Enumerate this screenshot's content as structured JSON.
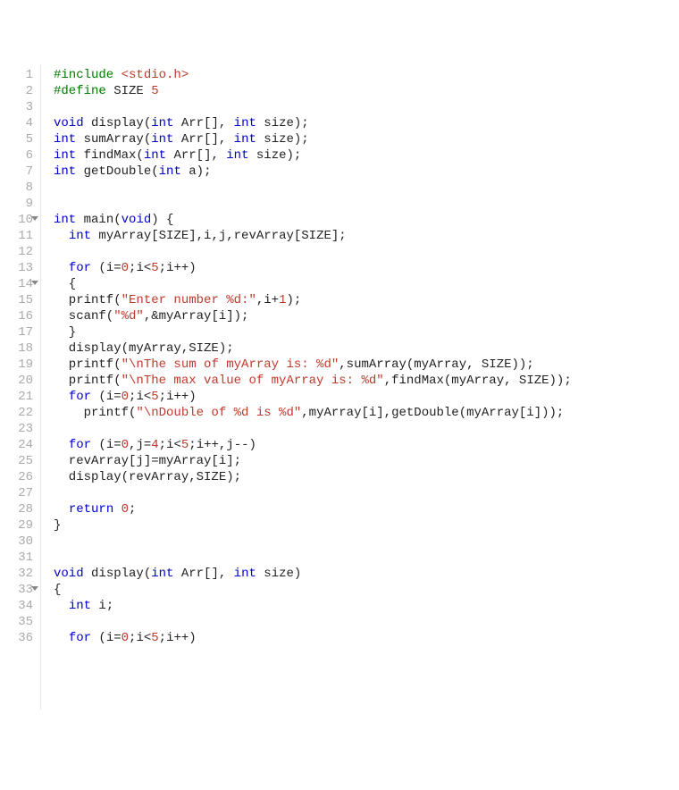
{
  "lines": [
    {
      "n": "1",
      "fold": false,
      "tokens": [
        [
          "pp",
          "#include "
        ],
        [
          "hdr",
          "<stdio.h>"
        ]
      ]
    },
    {
      "n": "2",
      "fold": false,
      "tokens": [
        [
          "pp",
          "#define "
        ],
        [
          "id",
          "SIZE "
        ],
        [
          "num",
          "5"
        ]
      ]
    },
    {
      "n": "3",
      "fold": false,
      "tokens": []
    },
    {
      "n": "4",
      "fold": false,
      "tokens": [
        [
          "kw",
          "void"
        ],
        [
          "id",
          " display("
        ],
        [
          "kw",
          "int"
        ],
        [
          "id",
          " Arr[], "
        ],
        [
          "kw",
          "int"
        ],
        [
          "id",
          " size);"
        ]
      ]
    },
    {
      "n": "5",
      "fold": false,
      "tokens": [
        [
          "kw",
          "int"
        ],
        [
          "id",
          " sumArray("
        ],
        [
          "kw",
          "int"
        ],
        [
          "id",
          " Arr[], "
        ],
        [
          "kw",
          "int"
        ],
        [
          "id",
          " size);"
        ]
      ]
    },
    {
      "n": "6",
      "fold": false,
      "tokens": [
        [
          "kw",
          "int"
        ],
        [
          "id",
          " findMax("
        ],
        [
          "kw",
          "int"
        ],
        [
          "id",
          " Arr[], "
        ],
        [
          "kw",
          "int"
        ],
        [
          "id",
          " size);"
        ]
      ]
    },
    {
      "n": "7",
      "fold": false,
      "tokens": [
        [
          "kw",
          "int"
        ],
        [
          "id",
          " getDouble("
        ],
        [
          "kw",
          "int"
        ],
        [
          "id",
          " a);"
        ]
      ]
    },
    {
      "n": "8",
      "fold": false,
      "tokens": []
    },
    {
      "n": "9",
      "fold": false,
      "tokens": []
    },
    {
      "n": "10",
      "fold": true,
      "tokens": [
        [
          "kw",
          "int"
        ],
        [
          "id",
          " main("
        ],
        [
          "kw",
          "void"
        ],
        [
          "id",
          ") {"
        ]
      ]
    },
    {
      "n": "11",
      "fold": false,
      "tokens": [
        [
          "id",
          "  "
        ],
        [
          "kw",
          "int"
        ],
        [
          "id",
          " myArray[SIZE],i,j,revArray[SIZE];"
        ]
      ]
    },
    {
      "n": "12",
      "fold": false,
      "tokens": [
        [
          "id",
          "  "
        ]
      ]
    },
    {
      "n": "13",
      "fold": false,
      "tokens": [
        [
          "id",
          "  "
        ],
        [
          "kw",
          "for"
        ],
        [
          "id",
          " (i="
        ],
        [
          "num",
          "0"
        ],
        [
          "id",
          ";i<"
        ],
        [
          "num",
          "5"
        ],
        [
          "id",
          ";i++)"
        ]
      ]
    },
    {
      "n": "14",
      "fold": true,
      "tokens": [
        [
          "id",
          "  {"
        ]
      ]
    },
    {
      "n": "15",
      "fold": false,
      "tokens": [
        [
          "id",
          "  printf("
        ],
        [
          "str",
          "\"Enter number %d:\""
        ],
        [
          "id",
          ",i+"
        ],
        [
          "num",
          "1"
        ],
        [
          "id",
          ");"
        ]
      ]
    },
    {
      "n": "16",
      "fold": false,
      "tokens": [
        [
          "id",
          "  scanf("
        ],
        [
          "str",
          "\"%d\""
        ],
        [
          "id",
          ",&myArray[i]);"
        ]
      ]
    },
    {
      "n": "17",
      "fold": false,
      "tokens": [
        [
          "id",
          "  }"
        ]
      ]
    },
    {
      "n": "18",
      "fold": false,
      "tokens": [
        [
          "id",
          "  display(myArray,SIZE);"
        ]
      ]
    },
    {
      "n": "19",
      "fold": false,
      "tokens": [
        [
          "id",
          "  printf("
        ],
        [
          "str",
          "\"\\nThe sum of myArray is: %d\""
        ],
        [
          "id",
          ",sumArray(myArray, SIZE));"
        ]
      ]
    },
    {
      "n": "20",
      "fold": false,
      "tokens": [
        [
          "id",
          "  printf("
        ],
        [
          "str",
          "\"\\nThe max value of myArray is: %d\""
        ],
        [
          "id",
          ",findMax(myArray, SIZE));"
        ]
      ]
    },
    {
      "n": "21",
      "fold": false,
      "tokens": [
        [
          "id",
          "  "
        ],
        [
          "kw",
          "for"
        ],
        [
          "id",
          " (i="
        ],
        [
          "num",
          "0"
        ],
        [
          "id",
          ";i<"
        ],
        [
          "num",
          "5"
        ],
        [
          "id",
          ";i++)"
        ]
      ]
    },
    {
      "n": "22",
      "fold": false,
      "tokens": [
        [
          "id",
          "    printf("
        ],
        [
          "str",
          "\"\\nDouble of %d is %d\""
        ],
        [
          "id",
          ",myArray[i],getDouble(myArray[i]));"
        ]
      ]
    },
    {
      "n": "23",
      "fold": false,
      "tokens": [
        [
          "id",
          "  "
        ]
      ]
    },
    {
      "n": "24",
      "fold": false,
      "tokens": [
        [
          "id",
          "  "
        ],
        [
          "kw",
          "for"
        ],
        [
          "id",
          " (i="
        ],
        [
          "num",
          "0"
        ],
        [
          "id",
          ",j="
        ],
        [
          "num",
          "4"
        ],
        [
          "id",
          ";i<"
        ],
        [
          "num",
          "5"
        ],
        [
          "id",
          ";i++,j--)"
        ]
      ]
    },
    {
      "n": "25",
      "fold": false,
      "tokens": [
        [
          "id",
          "  revArray[j]=myArray[i];"
        ]
      ]
    },
    {
      "n": "26",
      "fold": false,
      "tokens": [
        [
          "id",
          "  display(revArray,SIZE);"
        ]
      ]
    },
    {
      "n": "27",
      "fold": false,
      "tokens": [
        [
          "id",
          "  "
        ]
      ]
    },
    {
      "n": "28",
      "fold": false,
      "tokens": [
        [
          "id",
          "  "
        ],
        [
          "kw",
          "return"
        ],
        [
          "id",
          " "
        ],
        [
          "num",
          "0"
        ],
        [
          "id",
          ";"
        ]
      ]
    },
    {
      "n": "29",
      "fold": false,
      "tokens": [
        [
          "id",
          "}"
        ]
      ]
    },
    {
      "n": "30",
      "fold": false,
      "tokens": []
    },
    {
      "n": "31",
      "fold": false,
      "tokens": []
    },
    {
      "n": "32",
      "fold": false,
      "tokens": [
        [
          "kw",
          "void"
        ],
        [
          "id",
          " display("
        ],
        [
          "kw",
          "int"
        ],
        [
          "id",
          " Arr[], "
        ],
        [
          "kw",
          "int"
        ],
        [
          "id",
          " size)"
        ]
      ]
    },
    {
      "n": "33",
      "fold": true,
      "tokens": [
        [
          "id",
          "{"
        ]
      ]
    },
    {
      "n": "34",
      "fold": false,
      "tokens": [
        [
          "id",
          "  "
        ],
        [
          "kw",
          "int"
        ],
        [
          "id",
          " i;"
        ]
      ]
    },
    {
      "n": "35",
      "fold": false,
      "tokens": [
        [
          "id",
          "  "
        ]
      ]
    },
    {
      "n": "36",
      "fold": false,
      "tokens": [
        [
          "id",
          "  "
        ],
        [
          "kw",
          "for"
        ],
        [
          "id",
          " (i="
        ],
        [
          "num",
          "0"
        ],
        [
          "id",
          ";i<"
        ],
        [
          "num",
          "5"
        ],
        [
          "id",
          ";i++)"
        ]
      ]
    }
  ]
}
